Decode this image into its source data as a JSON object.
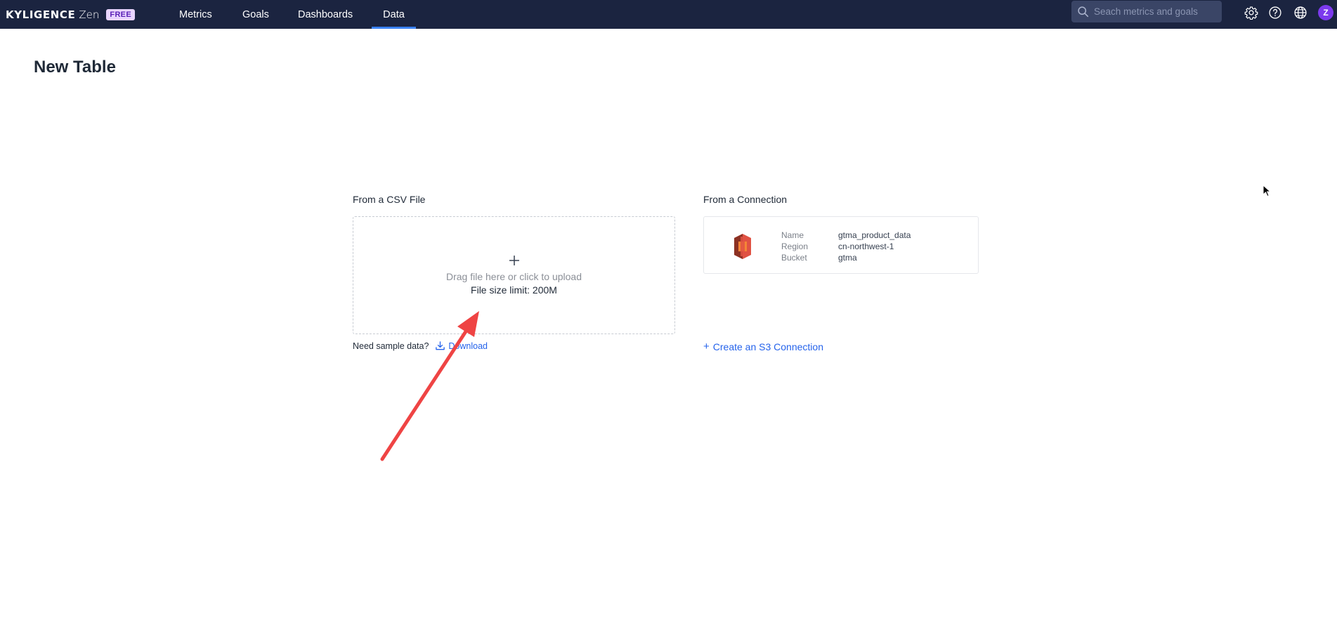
{
  "app": {
    "logo_text": "KYLIGENCE",
    "logo_suffix": "Zen",
    "plan_badge": "FREE"
  },
  "nav": {
    "items": [
      {
        "label": "Metrics"
      },
      {
        "label": "Goals"
      },
      {
        "label": "Dashboards"
      },
      {
        "label": "Data",
        "active": true
      }
    ]
  },
  "search": {
    "placeholder": "Seach metrics and goals"
  },
  "user": {
    "avatar_initial": "Z"
  },
  "page": {
    "title": "New Table"
  },
  "csv": {
    "section_label": "From a CSV File",
    "drop_hint": "Drag file here or click to upload",
    "size_limit": "File size limit: 200M",
    "sample_prompt": "Need sample data?",
    "download_label": "Download"
  },
  "connection": {
    "section_label": "From a Connection",
    "fields": [
      {
        "label": "Name",
        "value": "gtma_product_data"
      },
      {
        "label": "Region",
        "value": "cn-northwest-1"
      },
      {
        "label": "Bucket",
        "value": "gtma"
      }
    ],
    "create_label": "Create an S3 Connection"
  },
  "colors": {
    "topbar_bg": "#1b2440",
    "accent": "#2563eb",
    "badge_bg": "#e9d5ff",
    "avatar_bg": "#7c3aed",
    "annotation_arrow": "#ef4444"
  },
  "icons": {
    "search": "search-icon",
    "settings": "gear-icon",
    "help": "help-icon",
    "language": "globe-icon",
    "upload_add": "plus-icon",
    "download": "download-icon",
    "connection": "aws-s3-icon"
  }
}
